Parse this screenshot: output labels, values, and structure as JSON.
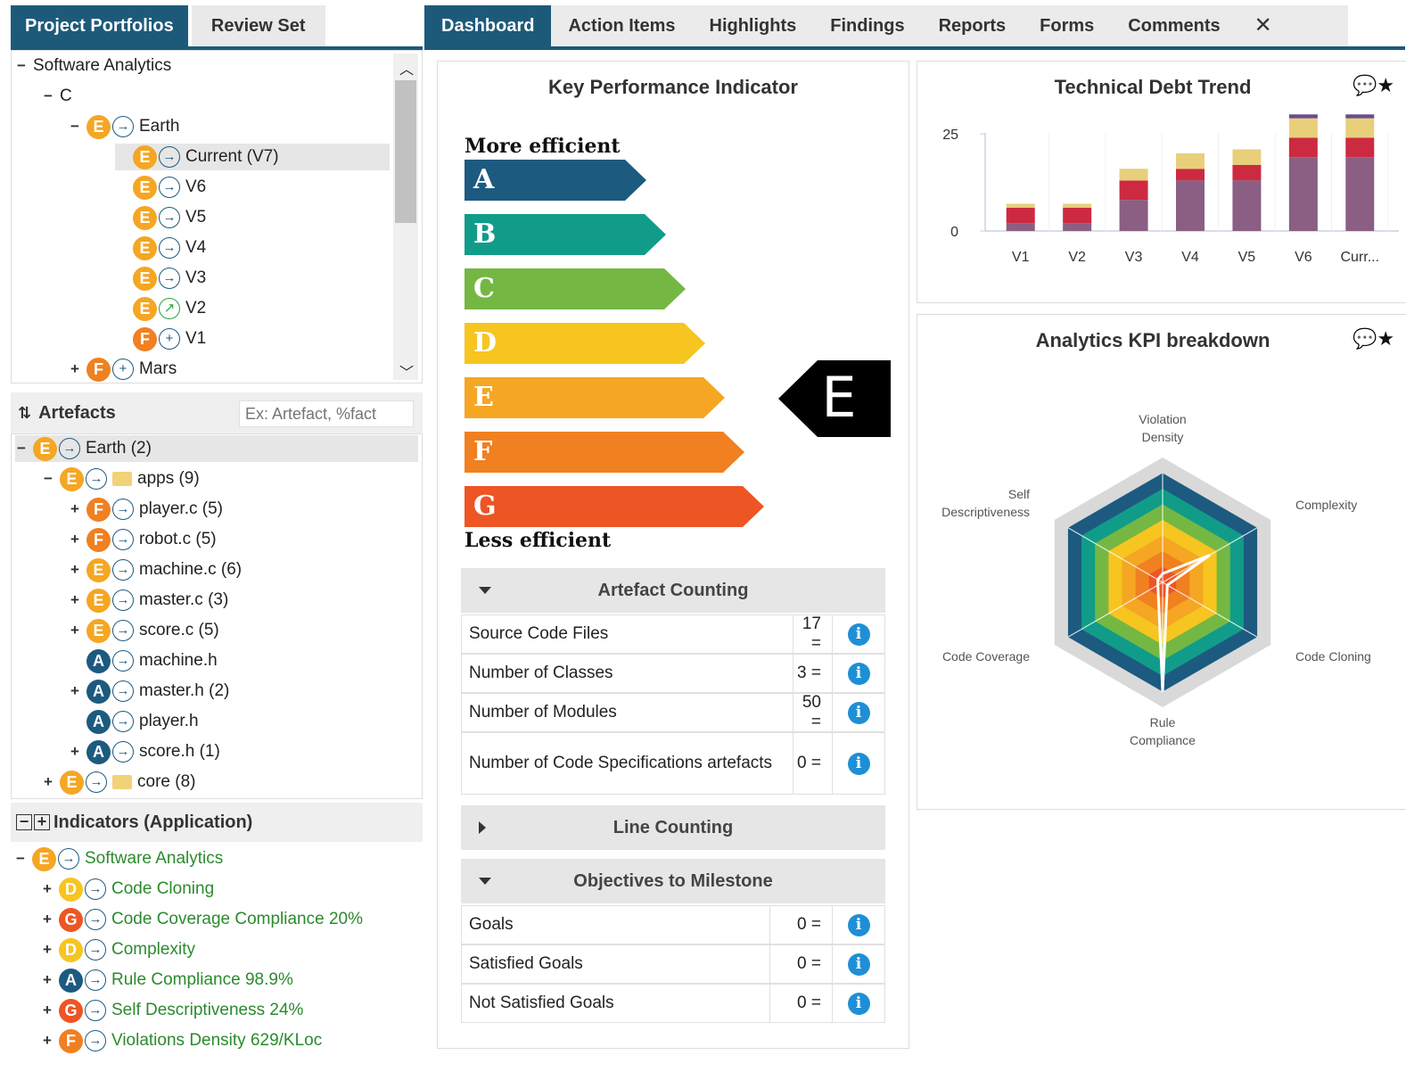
{
  "left_tabs": [
    "Project Portfolios",
    "Review Set"
  ],
  "portfolio_tree": [
    {
      "label": "Software Analytics",
      "toggle": "−"
    },
    {
      "label": "C",
      "toggle": "−"
    },
    {
      "label": "Earth",
      "grade": "E",
      "arrow": "→",
      "toggle": "−"
    },
    {
      "label": "Current (V7)",
      "grade": "E",
      "arrow": "→",
      "selected": true
    },
    {
      "label": "V6",
      "grade": "E",
      "arrow": "→"
    },
    {
      "label": "V5",
      "grade": "E",
      "arrow": "→"
    },
    {
      "label": "V4",
      "grade": "E",
      "arrow": "→"
    },
    {
      "label": "V3",
      "grade": "E",
      "arrow": "→"
    },
    {
      "label": "V2",
      "grade": "E",
      "arrow": "↗"
    },
    {
      "label": "V1",
      "grade": "F",
      "arrow": "+"
    },
    {
      "label": "Mars",
      "grade": "F",
      "arrow": "+",
      "toggle": "+"
    }
  ],
  "artefacts": {
    "title": "Artefacts",
    "filter_placeholder": "Ex: Artefact, %fact",
    "items": [
      {
        "label": "Earth (2)",
        "grade": "E",
        "toggle": "−"
      },
      {
        "label": "apps (9)",
        "grade": "E",
        "toggle": "−",
        "folder": true
      },
      {
        "label": "player.c (5)",
        "grade": "F",
        "toggle": "+"
      },
      {
        "label": "robot.c (5)",
        "grade": "F",
        "toggle": "+"
      },
      {
        "label": "machine.c (6)",
        "grade": "E",
        "toggle": "+"
      },
      {
        "label": "master.c (3)",
        "grade": "E",
        "toggle": "+"
      },
      {
        "label": "score.c (5)",
        "grade": "E",
        "toggle": "+"
      },
      {
        "label": "machine.h",
        "grade": "A",
        "toggle": ""
      },
      {
        "label": "master.h (2)",
        "grade": "A",
        "toggle": "+"
      },
      {
        "label": "player.h",
        "grade": "A",
        "toggle": ""
      },
      {
        "label": "score.h (1)",
        "grade": "A",
        "toggle": "+"
      },
      {
        "label": "core (8)",
        "grade": "E",
        "toggle": "+",
        "folder": true
      }
    ]
  },
  "indicators": {
    "title": "Indicators (Application)",
    "items": [
      {
        "label": "Software Analytics",
        "grade": "E",
        "toggle": "−"
      },
      {
        "label": "Code Cloning",
        "grade": "D",
        "toggle": "+"
      },
      {
        "label": "Code Coverage Compliance 20%",
        "grade": "G",
        "toggle": "+"
      },
      {
        "label": "Complexity",
        "grade": "D",
        "toggle": "+"
      },
      {
        "label": "Rule Compliance 98.9%",
        "grade": "A",
        "toggle": "+"
      },
      {
        "label": "Self Descriptiveness 24%",
        "grade": "G",
        "toggle": "+"
      },
      {
        "label": "Violations Density 629/KLoc",
        "grade": "F",
        "toggle": "+"
      }
    ]
  },
  "top_tabs": [
    "Dashboard",
    "Action Items",
    "Highlights",
    "Findings",
    "Reports",
    "Forms",
    "Comments"
  ],
  "kpi": {
    "title": "Key Performance Indicator",
    "more_efficient": "More efficient",
    "less_efficient": "Less efficient",
    "grades": [
      "A",
      "B",
      "C",
      "D",
      "E",
      "F",
      "G"
    ],
    "current_grade": "E"
  },
  "artefact_counting": {
    "title": "Artefact Counting",
    "rows": [
      {
        "label": "Source Code Files",
        "value": "17 ="
      },
      {
        "label": "Number of Classes",
        "value": "3 ="
      },
      {
        "label": "Number of Modules",
        "value": "50 ="
      },
      {
        "label": "Number of Code Specifications artefacts",
        "value": "0 ="
      }
    ]
  },
  "line_counting": {
    "title": "Line Counting"
  },
  "objectives": {
    "title": "Objectives to Milestone",
    "rows": [
      {
        "label": "Goals",
        "value": "0 ="
      },
      {
        "label": "Satisfied Goals",
        "value": "0 ="
      },
      {
        "label": "Not Satisfied Goals",
        "value": "0 ="
      }
    ]
  },
  "info_glyph": "i",
  "debt_chart": {
    "title": "Technical Debt Trend",
    "chart_data": {
      "type": "bar",
      "stacked": true,
      "categories": [
        "V1",
        "V2",
        "V3",
        "V4",
        "V5",
        "V6",
        "Curr..."
      ],
      "series": [
        {
          "color": "#8b5e83",
          "values": [
            2,
            2,
            8,
            13,
            13,
            19,
            19
          ]
        },
        {
          "color": "#cc2a41",
          "values": [
            4,
            4,
            5,
            3,
            4,
            5,
            5
          ]
        },
        {
          "color": "#e8cf7a",
          "values": [
            1,
            1,
            3,
            4,
            4,
            5,
            5
          ]
        },
        {
          "color": "#6a4c8b",
          "values": [
            0,
            0,
            0,
            0,
            0,
            1,
            1
          ]
        }
      ],
      "yticks": [
        0,
        25
      ],
      "ylim": [
        0,
        28
      ]
    }
  },
  "radar_chart": {
    "title": "Analytics KPI breakdown",
    "chart_data": {
      "type": "radar",
      "axes": [
        "Violation Density",
        "Complexity",
        "Code Cloning",
        "Rule Compliance",
        "Code Coverage",
        "Self Descriptiveness"
      ],
      "axis_lines": [
        [
          "Violation",
          "Density"
        ],
        [
          "Complexity"
        ],
        [
          "Code Cloning"
        ],
        [
          "Rule",
          "Compliance"
        ],
        [
          "Code Coverage"
        ],
        [
          "Self",
          "Descriptiveness"
        ]
      ],
      "values": [
        0.08,
        0.5,
        0.05,
        1.0,
        0.05,
        0.05
      ],
      "band_colors": [
        "#d9d9d9",
        "#1d5a80",
        "#119c89",
        "#74b843",
        "#f6c520",
        "#f5a623",
        "#f08020",
        "#ee5524"
      ]
    }
  },
  "panel_icons": "💬★"
}
